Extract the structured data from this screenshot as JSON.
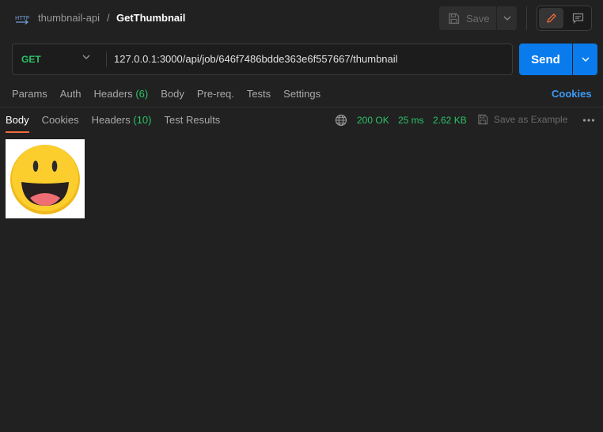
{
  "header": {
    "breadcrumb_parent": "thumbnail-api",
    "breadcrumb_separator": "/",
    "request_name": "GetThumbnail",
    "save_label": "Save"
  },
  "request": {
    "method": "GET",
    "url": "127.0.0.1:3000/api/job/646f7486bdde363e6f557667/thumbnail",
    "send_label": "Send"
  },
  "request_tabs": {
    "params": "Params",
    "auth": "Auth",
    "headers": "Headers",
    "headers_count": "(6)",
    "body": "Body",
    "prereq": "Pre-req.",
    "tests": "Tests",
    "settings": "Settings",
    "cookies": "Cookies"
  },
  "response_tabs": {
    "body": "Body",
    "cookies": "Cookies",
    "headers": "Headers",
    "headers_count": "(10)",
    "test_results": "Test Results"
  },
  "response": {
    "status": "200 OK",
    "time": "25 ms",
    "size": "2.62 KB",
    "save_as_example": "Save as Example"
  },
  "colors": {
    "accent_blue": "#097bed",
    "status_green": "#2bc267",
    "active_tab_orange": "#f26b3a"
  },
  "icons": {
    "request_type": "http-icon",
    "save": "floppy-disk-icon",
    "edit": "pencil-icon",
    "docs": "comment-icon",
    "network": "globe-icon",
    "more": "ellipsis-icon",
    "preview": "smiley-face-image"
  }
}
